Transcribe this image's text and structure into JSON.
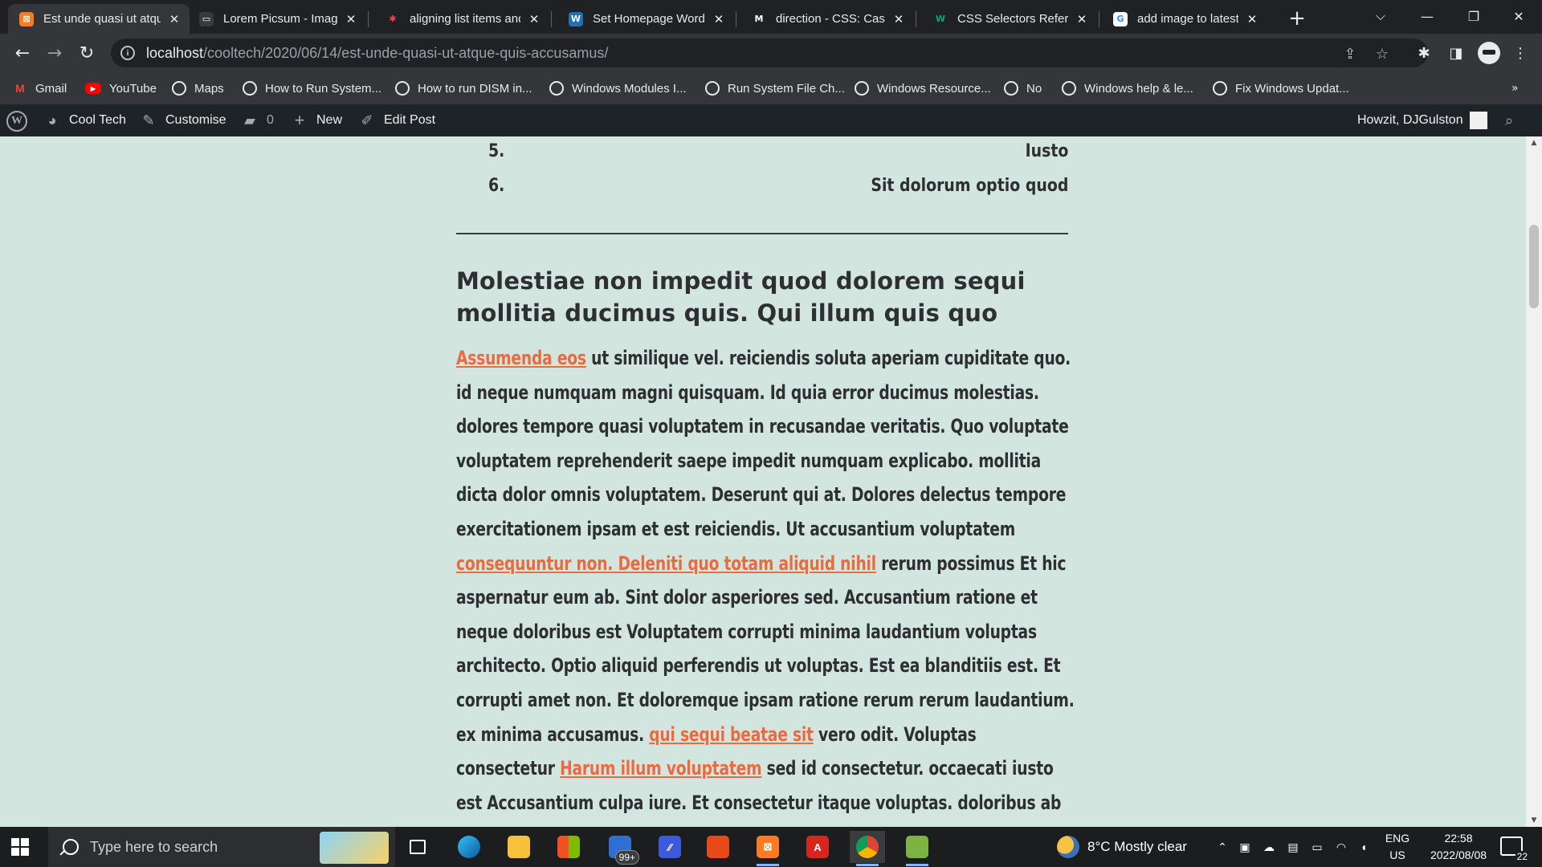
{
  "browser": {
    "tabs": [
      {
        "title": "Est unde quasi ut atqu",
        "active": true,
        "favicon": "xampp-icon",
        "color": "#fb7a24",
        "glyph": "⊠"
      },
      {
        "title": "Lorem Picsum - Imag",
        "active": false,
        "favicon": "picsum-icon",
        "color": "#3a3a3a",
        "glyph": "▭"
      },
      {
        "title": "aligning list items and",
        "active": false,
        "favicon": "asterisk-icon",
        "color": "transparent",
        "glyph": "✱"
      },
      {
        "title": "Set Homepage Word",
        "active": false,
        "favicon": "wordpress-icon",
        "color": "#2271b1",
        "glyph": "W"
      },
      {
        "title": "direction - CSS: Casca",
        "active": false,
        "favicon": "mdn-icon",
        "color": "transparent",
        "glyph": "M"
      },
      {
        "title": "CSS Selectors Referen",
        "active": false,
        "favicon": "w3schools-icon",
        "color": "transparent",
        "glyph": "W"
      },
      {
        "title": "add image to latest p",
        "active": false,
        "favicon": "google-icon",
        "color": "#ffffff",
        "glyph": "G"
      }
    ],
    "new_tab": "+",
    "url_host": "localhost",
    "url_path": "/cooltech/2020/06/14/est-unde-quasi-ut-atque-quis-accusamus/",
    "bookmarks": [
      {
        "label": "Gmail",
        "icon": "gmail-icon"
      },
      {
        "label": "YouTube",
        "icon": "youtube-icon"
      },
      {
        "label": "Maps",
        "icon": "globe-icon"
      },
      {
        "label": "How to Run System...",
        "icon": "globe-icon"
      },
      {
        "label": "How to run DISM in...",
        "icon": "globe-icon"
      },
      {
        "label": "Windows Modules I...",
        "icon": "globe-icon"
      },
      {
        "label": "Run System File Ch...",
        "icon": "globe-icon"
      },
      {
        "label": "Windows Resource...",
        "icon": "globe-icon"
      },
      {
        "label": "No",
        "icon": "globe-icon"
      },
      {
        "label": "Windows help & le...",
        "icon": "globe-icon"
      },
      {
        "label": "Fix Windows Updat...",
        "icon": "globe-icon"
      }
    ]
  },
  "adminbar": {
    "site": "Cool Tech",
    "customise": "Customise",
    "comments": "0",
    "new": "New",
    "edit": "Edit Post",
    "greeting": "Howzit, DJGulston"
  },
  "content": {
    "list": [
      {
        "num": "5.",
        "text": "Iusto"
      },
      {
        "num": "6.",
        "text": "Sit dolorum optio quod"
      }
    ],
    "heading": "Molestiae non impedit quod dolorem sequi mollitia ducimus quis. Qui illum quis quo",
    "lines": [
      [
        {
          "t": "Assumenda eos",
          "link": true
        },
        {
          "t": " ut similique vel. reiciendis soluta aperiam cupiditate quo."
        }
      ],
      [
        {
          "t": "id neque numquam magni quisquam. Id quia error ducimus molestias."
        }
      ],
      [
        {
          "t": "dolores tempore quasi voluptatem in recusandae veritatis. Quo voluptate"
        }
      ],
      [
        {
          "t": "voluptatem reprehenderit saepe impedit numquam explicabo. mollitia"
        }
      ],
      [
        {
          "t": "dicta dolor omnis voluptatem. Deserunt qui at. Dolores delectus tempore"
        }
      ],
      [
        {
          "t": "exercitationem ipsam et est reiciendis. Ut accusantium voluptatem"
        }
      ],
      [
        {
          "t": "consequuntur non. Deleniti quo totam aliquid nihil",
          "link": true
        },
        {
          "t": " rerum possimus Et hic"
        }
      ],
      [
        {
          "t": "aspernatur eum ab. Sint dolor asperiores sed. Accusantium ratione et"
        }
      ],
      [
        {
          "t": "neque doloribus est Voluptatem corrupti minima laudantium voluptas"
        }
      ],
      [
        {
          "t": "architecto. Optio aliquid perferendis ut voluptas. Est ea blanditiis est. Et"
        }
      ],
      [
        {
          "t": "corrupti amet non. Et doloremque ipsam ratione rerum rerum laudantium."
        }
      ],
      [
        {
          "t": "ex minima accusamus. "
        },
        {
          "t": "qui sequi beatae sit",
          "link": true
        },
        {
          "t": " vero odit. Voluptas"
        }
      ],
      [
        {
          "t": "consectetur "
        },
        {
          "t": "Harum illum voluptatem",
          "link": true
        },
        {
          "t": " sed id consectetur. occaecati iusto"
        }
      ],
      [
        {
          "t": "est Accusantium culpa iure. Et consectetur itaque voluptas. doloribus ab"
        }
      ]
    ]
  },
  "taskbar": {
    "search_placeholder": "Type here to search",
    "mail_badge": "99+",
    "weather": "8°C  Mostly clear",
    "lang_top": "ENG",
    "lang_bottom": "US",
    "time": "22:58",
    "date": "2022/08/08",
    "notifications": "22"
  },
  "colors": {
    "page_bg": "#d3e5df",
    "link": "#ea6b3f",
    "text": "#2d2f31",
    "adminbar": "#1d2327"
  }
}
